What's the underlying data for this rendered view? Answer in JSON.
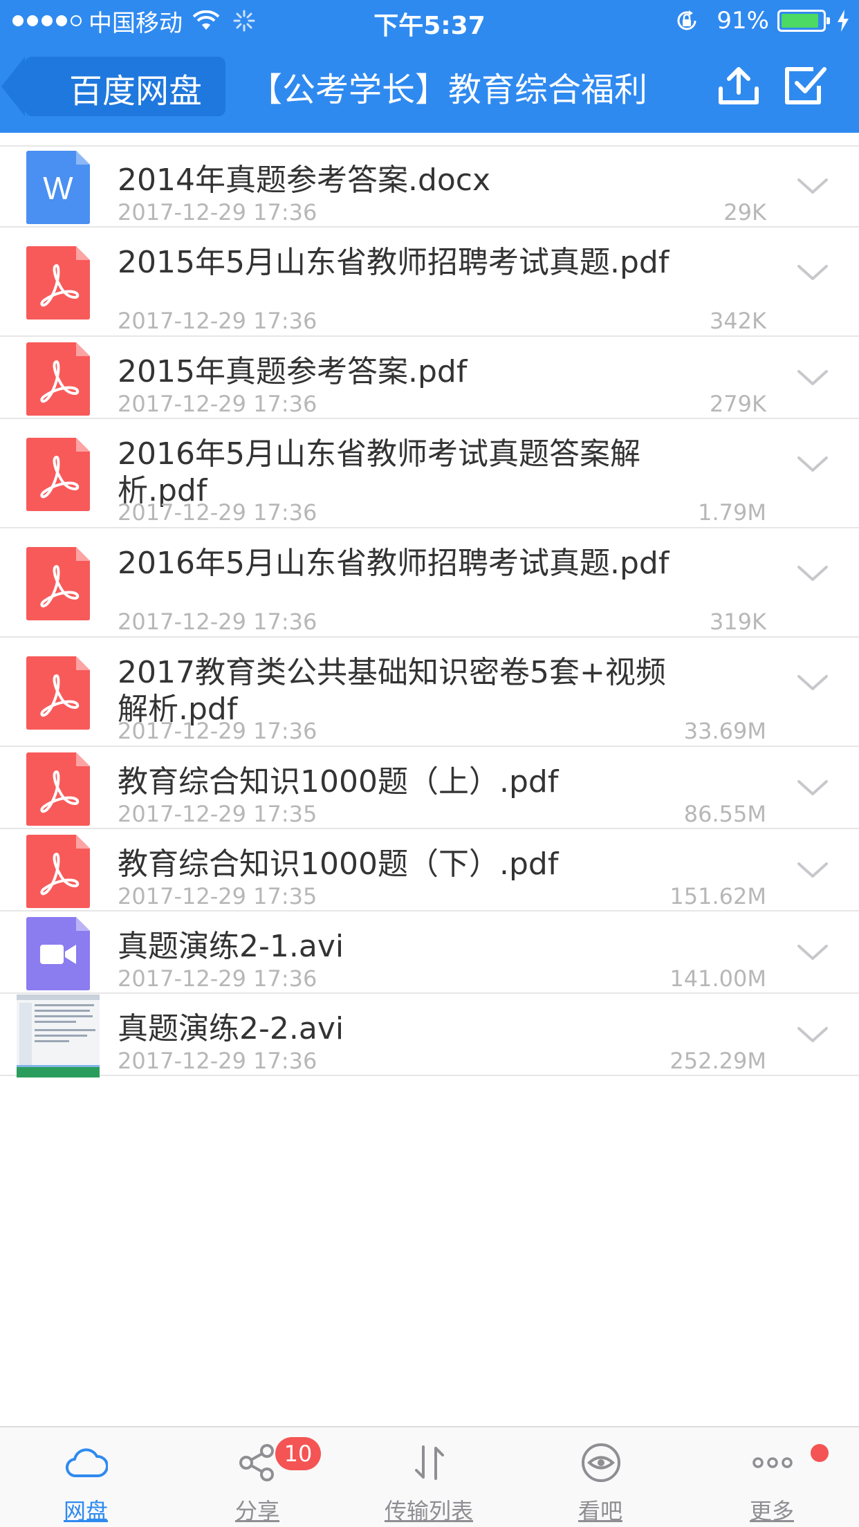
{
  "status_bar": {
    "carrier": "中国移动",
    "time": "下午5:37",
    "battery": "91%",
    "battery_level": 0.91
  },
  "nav": {
    "back_label": "百度网盘",
    "title": "【公考学长】教育综合福利",
    "upload_icon": "upload-icon",
    "select_icon": "checkbox-select-icon"
  },
  "files": [
    {
      "name": "2014年真题参考答案.docx",
      "date": "2017-12-29 17:36",
      "size": "29K",
      "type": "word"
    },
    {
      "name": "2015年5月山东省教师招聘考试真题.pdf",
      "date": "2017-12-29 17:36",
      "size": "342K",
      "type": "pdf"
    },
    {
      "name": "2015年真题参考答案.pdf",
      "date": "2017-12-29 17:36",
      "size": "279K",
      "type": "pdf"
    },
    {
      "name": "2016年5月山东省教师考试真题答案解析.pdf",
      "date": "2017-12-29 17:36",
      "size": "1.79M",
      "type": "pdf"
    },
    {
      "name": "2016年5月山东省教师招聘考试真题.pdf",
      "date": "2017-12-29 17:36",
      "size": "319K",
      "type": "pdf"
    },
    {
      "name": "2017教育类公共基础知识密卷5套+视频解析.pdf",
      "date": "2017-12-29 17:36",
      "size": "33.69M",
      "type": "pdf"
    },
    {
      "name": "教育综合知识1000题（上）.pdf",
      "date": "2017-12-29 17:35",
      "size": "86.55M",
      "type": "pdf"
    },
    {
      "name": "教育综合知识1000题（下）.pdf",
      "date": "2017-12-29 17:35",
      "size": "151.62M",
      "type": "pdf"
    },
    {
      "name": "真题演练2-1.avi",
      "date": "2017-12-29 17:36",
      "size": "141.00M",
      "type": "video"
    },
    {
      "name": "真题演练2-2.avi",
      "date": "2017-12-29 17:36",
      "size": "252.29M",
      "type": "thumbnail"
    }
  ],
  "tabs": [
    {
      "label": "网盘",
      "icon": "cloud-icon",
      "active": true
    },
    {
      "label": "分享",
      "icon": "share-icon",
      "badge": "10"
    },
    {
      "label": "传输列表",
      "icon": "transfer-icon"
    },
    {
      "label": "看吧",
      "icon": "eye-icon"
    },
    {
      "label": "更多",
      "icon": "more-icon",
      "dot": true
    }
  ],
  "colors": {
    "header_blue": "#2f8af0",
    "pdf_red": "#f85a5a",
    "word_blue": "#4a8ff2",
    "video_purple": "#8b7cf0",
    "badge_red": "#f45454"
  }
}
